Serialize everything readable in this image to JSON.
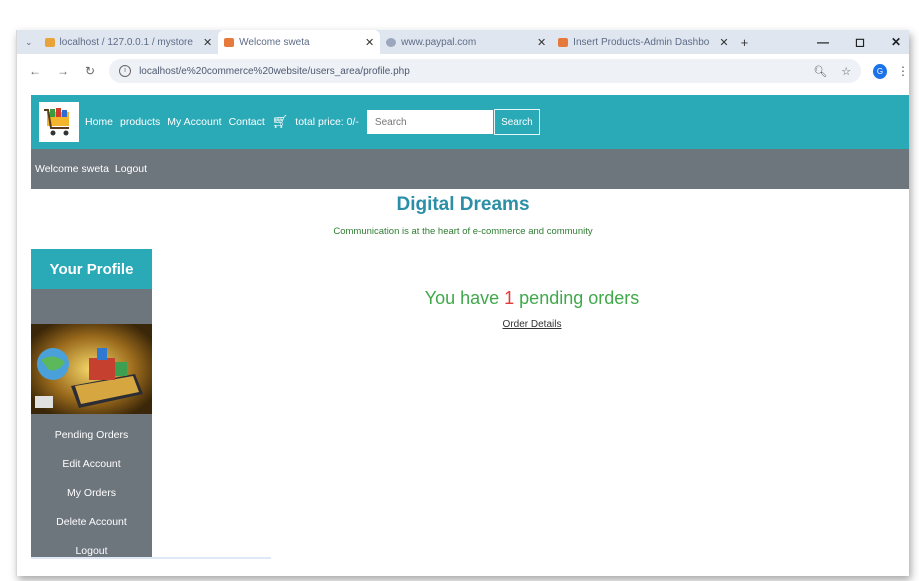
{
  "browser": {
    "tabs": [
      {
        "label": "localhost / 127.0.0.1 / mystore",
        "favicon_color": "#e8a33b"
      },
      {
        "label": "Welcome sweta",
        "favicon_color": "#e57a3c"
      },
      {
        "label": "www.paypal.com",
        "favicon_color": "#9aa7bd"
      },
      {
        "label": "Insert Products-Admin Dashbo",
        "favicon_color": "#e57a3c"
      }
    ],
    "close_glyph": "✕",
    "new_tab_glyph": "+",
    "window_controls": [
      "—",
      "◻",
      "✕"
    ],
    "url": "localhost/e%20commerce%20website/users_area/profile.php",
    "avatar_letter": "G"
  },
  "header": {
    "menu": [
      "Home",
      "products",
      "My Account",
      "Contact"
    ],
    "cart_icon": "cart-icon",
    "total_price": "total price: 0/-",
    "search_placeholder": "Search",
    "search_button": "Search"
  },
  "welcome_bar": {
    "welcome": "Welcome sweta",
    "logout": "Logout"
  },
  "brand": {
    "title": "Digital Dreams",
    "tagline": "Communication is at the heart of e-commerce and community"
  },
  "sidebar": {
    "title": "Your Profile",
    "links": [
      "Pending Orders",
      "Edit Account",
      "My Orders",
      "Delete Account",
      "Logout"
    ]
  },
  "main": {
    "pending_prefix": "You have ",
    "pending_count": "1",
    "pending_suffix": " pending orders",
    "order_details": "Order Details"
  },
  "colors": {
    "accent": "#2aa9b7",
    "bar": "#6d757d",
    "brand": "#2b8fa7",
    "pending_text": "#3fa94a",
    "pending_count": "#e53935"
  }
}
